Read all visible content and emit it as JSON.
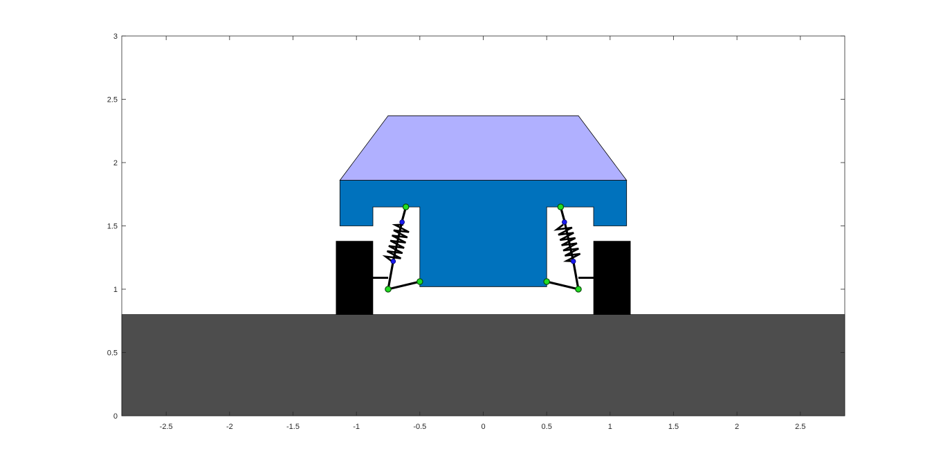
{
  "axes": {
    "xlim": [
      -2.85,
      2.85
    ],
    "ylim": [
      0,
      3
    ],
    "x_ticks": [
      -2.5,
      -2,
      -1.5,
      -1,
      -0.5,
      0,
      0.5,
      1,
      1.5,
      2,
      2.5
    ],
    "y_ticks": [
      0,
      0.5,
      1,
      1.5,
      2,
      2.5,
      3
    ],
    "x_tick_labels": [
      "-2.5",
      "-2",
      "-1.5",
      "-1",
      "-0.5",
      "0",
      "0.5",
      "1",
      "1.5",
      "2",
      "2.5"
    ],
    "y_tick_labels": [
      "0",
      "0.5",
      "1",
      "1.5",
      "2",
      "2.5",
      "3"
    ],
    "box": true,
    "grid": false
  },
  "scene": {
    "ground": {
      "polygon": [
        [
          -2.85,
          0
        ],
        [
          2.85,
          0
        ],
        [
          2.85,
          0.8
        ],
        [
          -2.85,
          0.8
        ]
      ],
      "color": "#4d4d4d"
    },
    "cabin": {
      "polygon": [
        [
          -1.13,
          1.86
        ],
        [
          1.13,
          1.86
        ],
        [
          0.75,
          2.37
        ],
        [
          -0.75,
          2.37
        ]
      ],
      "color": "#b0b0ff"
    },
    "body": {
      "polygon": [
        [
          -1.13,
          1.86
        ],
        [
          1.13,
          1.86
        ],
        [
          1.13,
          1.5
        ],
        [
          0.87,
          1.5
        ],
        [
          0.87,
          1.65
        ],
        [
          0.5,
          1.65
        ],
        [
          0.5,
          1.02
        ],
        [
          -0.5,
          1.02
        ],
        [
          -0.5,
          1.65
        ],
        [
          -0.87,
          1.65
        ],
        [
          -0.87,
          1.5
        ],
        [
          -1.13,
          1.5
        ]
      ],
      "color": "#0072bd"
    },
    "wheels": [
      {
        "side": "left",
        "polygon": [
          [
            -1.16,
            0.8
          ],
          [
            -0.87,
            0.8
          ],
          [
            -0.87,
            1.38
          ],
          [
            -1.16,
            1.38
          ]
        ],
        "color": "#000000"
      },
      {
        "side": "right",
        "polygon": [
          [
            0.87,
            0.8
          ],
          [
            1.16,
            0.8
          ],
          [
            1.16,
            1.38
          ],
          [
            0.87,
            1.38
          ]
        ],
        "color": "#000000"
      }
    ],
    "axle_links": [
      {
        "side": "left",
        "from": [
          -0.87,
          1.09
        ],
        "to": [
          -0.75,
          1.09
        ]
      },
      {
        "side": "right",
        "from": [
          0.75,
          1.09
        ],
        "to": [
          0.87,
          1.09
        ]
      }
    ],
    "uprights": [
      {
        "side": "left",
        "points": [
          [
            -0.61,
            1.65
          ],
          [
            -0.64,
            1.54
          ],
          [
            -0.71,
            1.22
          ],
          [
            -0.75,
            1.0
          ]
        ]
      },
      {
        "side": "right",
        "points": [
          [
            0.61,
            1.65
          ],
          [
            0.64,
            1.54
          ],
          [
            0.71,
            1.22
          ],
          [
            0.75,
            1.0
          ]
        ]
      }
    ],
    "lower_arms": [
      {
        "side": "left",
        "from": [
          -0.75,
          1.0
        ],
        "to": [
          -0.5,
          1.06
        ]
      },
      {
        "side": "right",
        "from": [
          0.5,
          1.06
        ],
        "to": [
          0.75,
          1.0
        ]
      }
    ],
    "springs": [
      {
        "side": "left",
        "top": [
          -0.63,
          1.51
        ],
        "bottom": [
          -0.72,
          1.22
        ],
        "coils": 7,
        "amplitude": 0.06
      },
      {
        "side": "right",
        "top": [
          0.63,
          1.51
        ],
        "bottom": [
          0.72,
          1.22
        ],
        "coils": 7,
        "amplitude": 0.06
      }
    ],
    "joints_green": [
      [
        -0.61,
        1.65
      ],
      [
        -0.5,
        1.06
      ],
      [
        -0.75,
        1.0
      ],
      [
        0.61,
        1.65
      ],
      [
        0.5,
        1.06
      ],
      [
        0.75,
        1.0
      ]
    ],
    "joints_blue": [
      [
        -0.64,
        1.53
      ],
      [
        -0.71,
        1.22
      ],
      [
        0.64,
        1.53
      ],
      [
        0.71,
        1.22
      ]
    ],
    "colors": {
      "link": "#000000",
      "joint_green": "#22dd22",
      "joint_blue": "#1a1aee",
      "axis": "#262626"
    }
  }
}
